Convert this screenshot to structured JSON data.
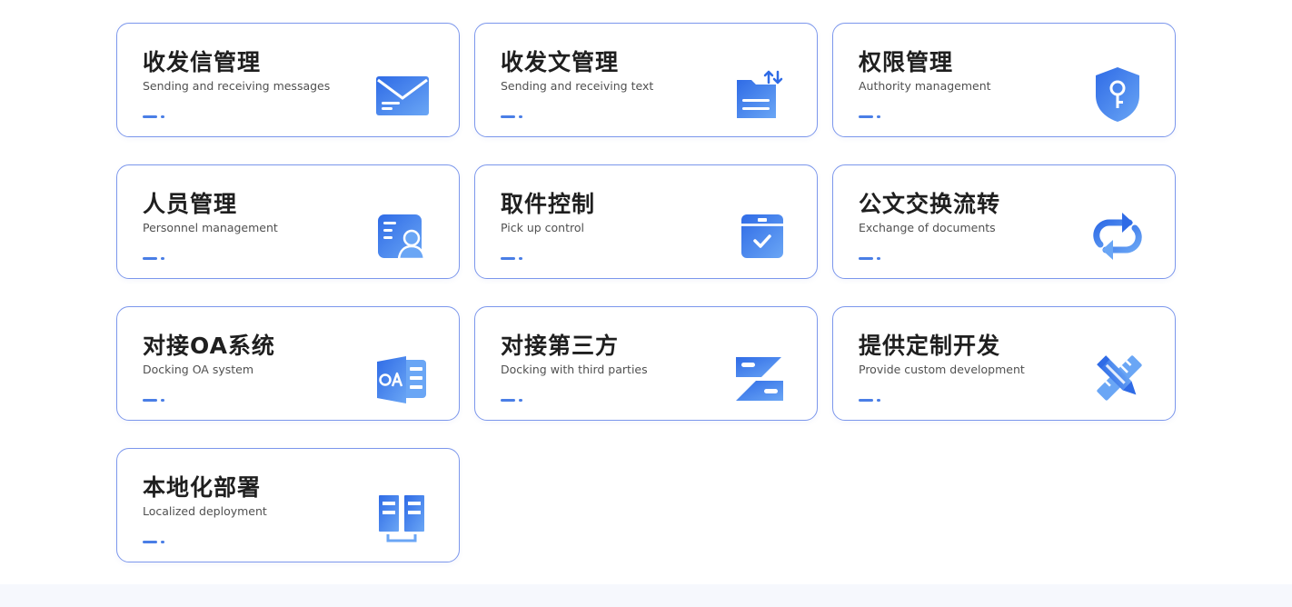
{
  "accent_gradient": [
    "#2f6be6",
    "#6aa6f5"
  ],
  "cards": [
    {
      "title": "收发信管理",
      "subtitle": "Sending and receiving messages",
      "icon": "envelope-icon"
    },
    {
      "title": "收发文管理",
      "subtitle": "Sending and receiving text",
      "icon": "document-transfer-icon"
    },
    {
      "title": "权限管理",
      "subtitle": "Authority management",
      "icon": "shield-key-icon"
    },
    {
      "title": "人员管理",
      "subtitle": "Personnel management",
      "icon": "user-card-icon"
    },
    {
      "title": "取件控制",
      "subtitle": "Pick up control",
      "icon": "package-check-icon"
    },
    {
      "title": "公文交换流转",
      "subtitle": "Exchange of documents",
      "icon": "cycle-arrows-icon"
    },
    {
      "title": "对接OA系统",
      "subtitle": "Docking OA system",
      "icon": "oa-app-icon"
    },
    {
      "title": "对接第三方",
      "subtitle": "Docking with third parties",
      "icon": "connector-icon"
    },
    {
      "title": "提供定制开发",
      "subtitle": "Provide custom development",
      "icon": "pencil-ruler-icon"
    },
    {
      "title": "本地化部署",
      "subtitle": "Localized deployment",
      "icon": "server-rack-icon"
    }
  ]
}
